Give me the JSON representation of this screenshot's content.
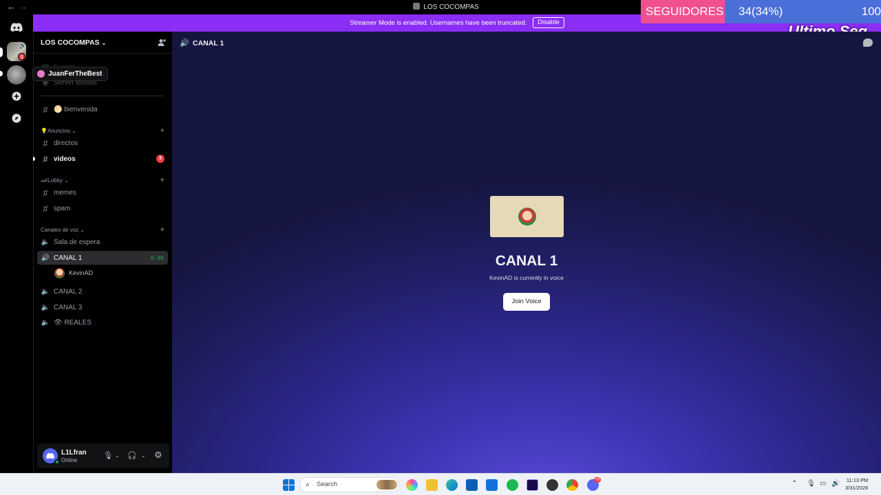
{
  "window": {
    "title": "LOS COCOMPAS",
    "back_glyph": "←",
    "forward_glyph": "→"
  },
  "banner": {
    "message": "Streamer Mode is enabled. Usernames have been truncated.",
    "disable_label": "Disable",
    "color": "#8b2ef5"
  },
  "overlay": {
    "followers_label": "SEGUIDORES!!",
    "followers_count": "34(34%)",
    "followers_goal": "100",
    "last_label": "Ultimo Seg"
  },
  "rail": {
    "server1_badge": "3",
    "server2_tooltip": "JuanFerTheBest"
  },
  "server": {
    "name": "LOS COCOMPAS",
    "boosts_label": "Server Boosts",
    "events_label": "Events"
  },
  "channels": {
    "welcome": "bienvenida",
    "cat_announcements": "Anuncios",
    "directos": "directos",
    "videos": "videos",
    "videos_badge": "3",
    "cat_lobby": "Lobby",
    "memes": "memes",
    "spam": "spam",
    "cat_voice": "Canales de voz",
    "sala": "Sala de espera",
    "canal1": "CANAL 1",
    "canal1_timer": "0:00",
    "canal1_user": "KevinAD",
    "canal2": "CANAL 2",
    "canal3": "CANAL 3",
    "reales": "REALES"
  },
  "user": {
    "name": "L1Lfran",
    "status": "Online"
  },
  "main": {
    "header": "CANAL 1",
    "title": "CANAL 1",
    "subtitle": "KevinAD is currently in voice",
    "join_label": "Join Voice"
  },
  "taskbar": {
    "search_placeholder": "Search",
    "time": "11:13 PM",
    "date": "3/31/2026",
    "discord_badge": "+9"
  }
}
